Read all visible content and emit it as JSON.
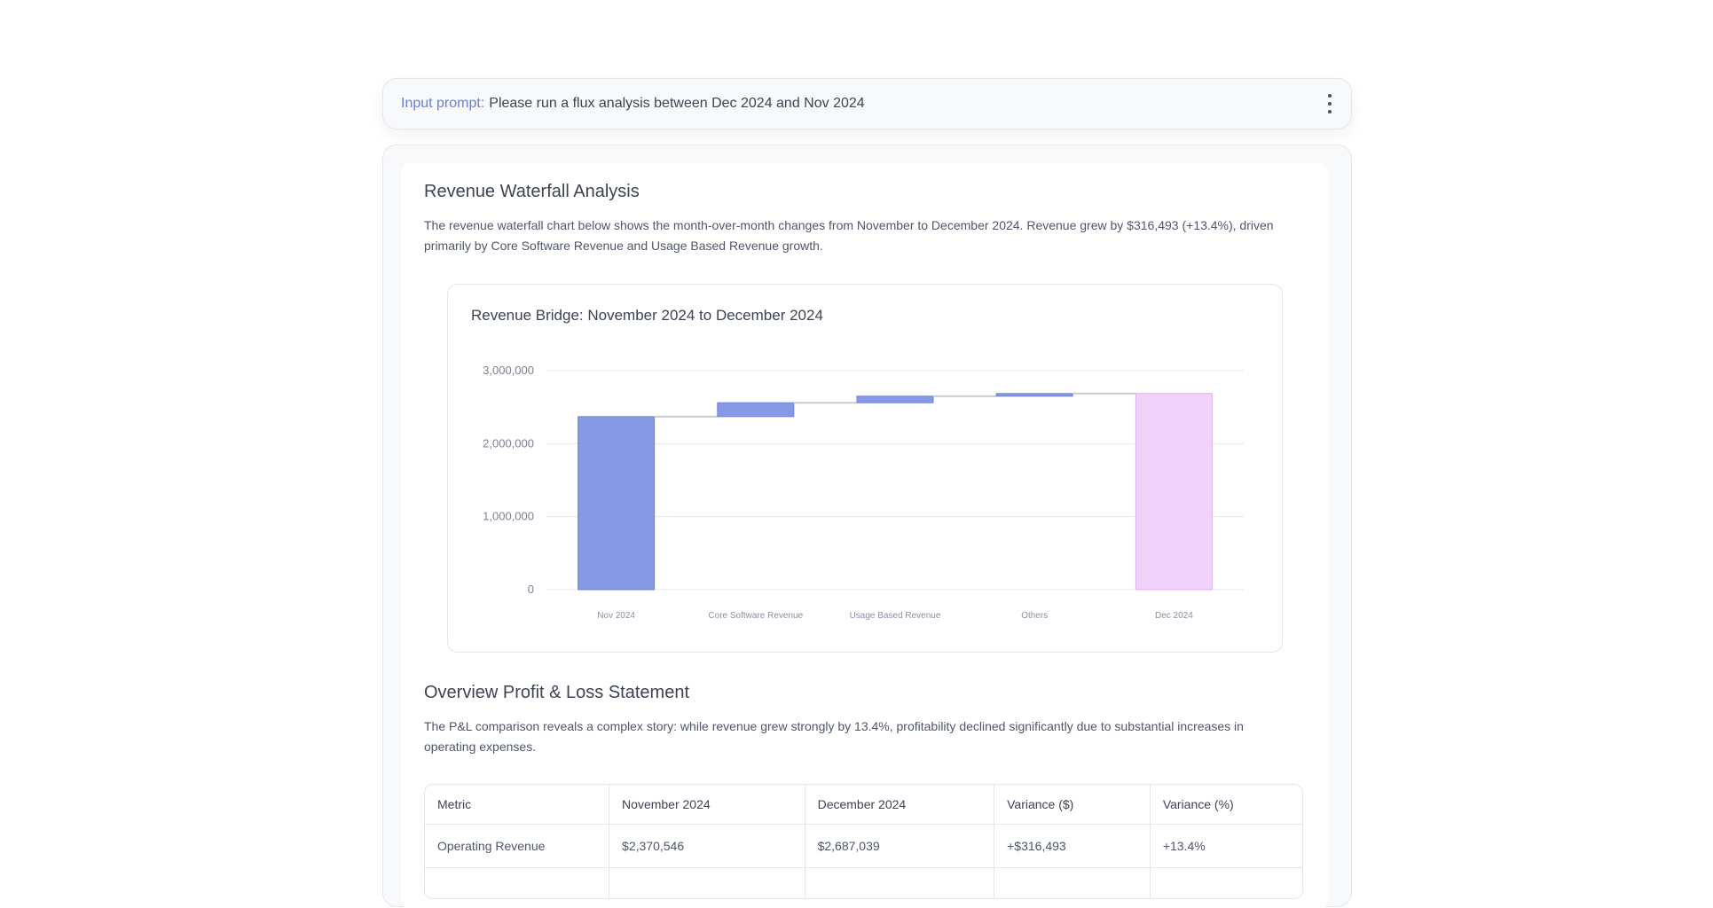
{
  "prompt": {
    "label": "Input prompt:",
    "text": "Please run a flux analysis between Dec 2024 and Nov 2024"
  },
  "waterfall_section": {
    "title": "Revenue Waterfall Analysis",
    "description": "The revenue waterfall chart below shows the month-over-month changes from November to December 2024. Revenue grew by $316,493 (+13.4%), driven primarily by Core Software Revenue and Usage Based Revenue growth."
  },
  "chart_data": {
    "type": "bar",
    "subtype": "waterfall",
    "title": "Revenue Bridge: November 2024 to December 2024",
    "xlabel": "",
    "ylabel": "",
    "ylim": [
      0,
      3000000
    ],
    "yticks": [
      0,
      1000000,
      2000000,
      3000000
    ],
    "ytick_labels": [
      "0",
      "1,000,000",
      "2,000,000",
      "3,000,000"
    ],
    "grid": true,
    "categories": [
      "Nov 2024",
      "Core Software Revenue",
      "Usage Based Revenue",
      "Others",
      "Dec 2024"
    ],
    "bars": [
      {
        "kind": "total",
        "start": 0,
        "end": 2370546
      },
      {
        "kind": "delta",
        "start": 2370546,
        "end": 2560000
      },
      {
        "kind": "delta",
        "start": 2560000,
        "end": 2650000
      },
      {
        "kind": "delta",
        "start": 2650000,
        "end": 2687039
      },
      {
        "kind": "total",
        "start": 0,
        "end": 2687039
      }
    ],
    "colors": {
      "total_start": "#8599e6",
      "delta": "#8599e6",
      "total_end": "#f0d2fb",
      "total_end_border": "#dcaef0",
      "connector": "#c8ccd6",
      "grid": "#e6e8ee"
    }
  },
  "pl_section": {
    "title": "Overview Profit & Loss Statement",
    "description": "The P&L comparison reveals a complex story: while revenue grew strongly by 13.4%, profitability declined significantly due to substantial increases in operating expenses."
  },
  "pl_table": {
    "headers": [
      "Metric",
      "November 2024",
      "December 2024",
      "Variance ($)",
      "Variance (%)"
    ],
    "rows": [
      [
        "Operating Revenue",
        "$2,370,546",
        "$2,687,039",
        "+$316,493",
        "+13.4%"
      ],
      [
        "",
        "",
        "",
        "",
        ""
      ]
    ]
  }
}
